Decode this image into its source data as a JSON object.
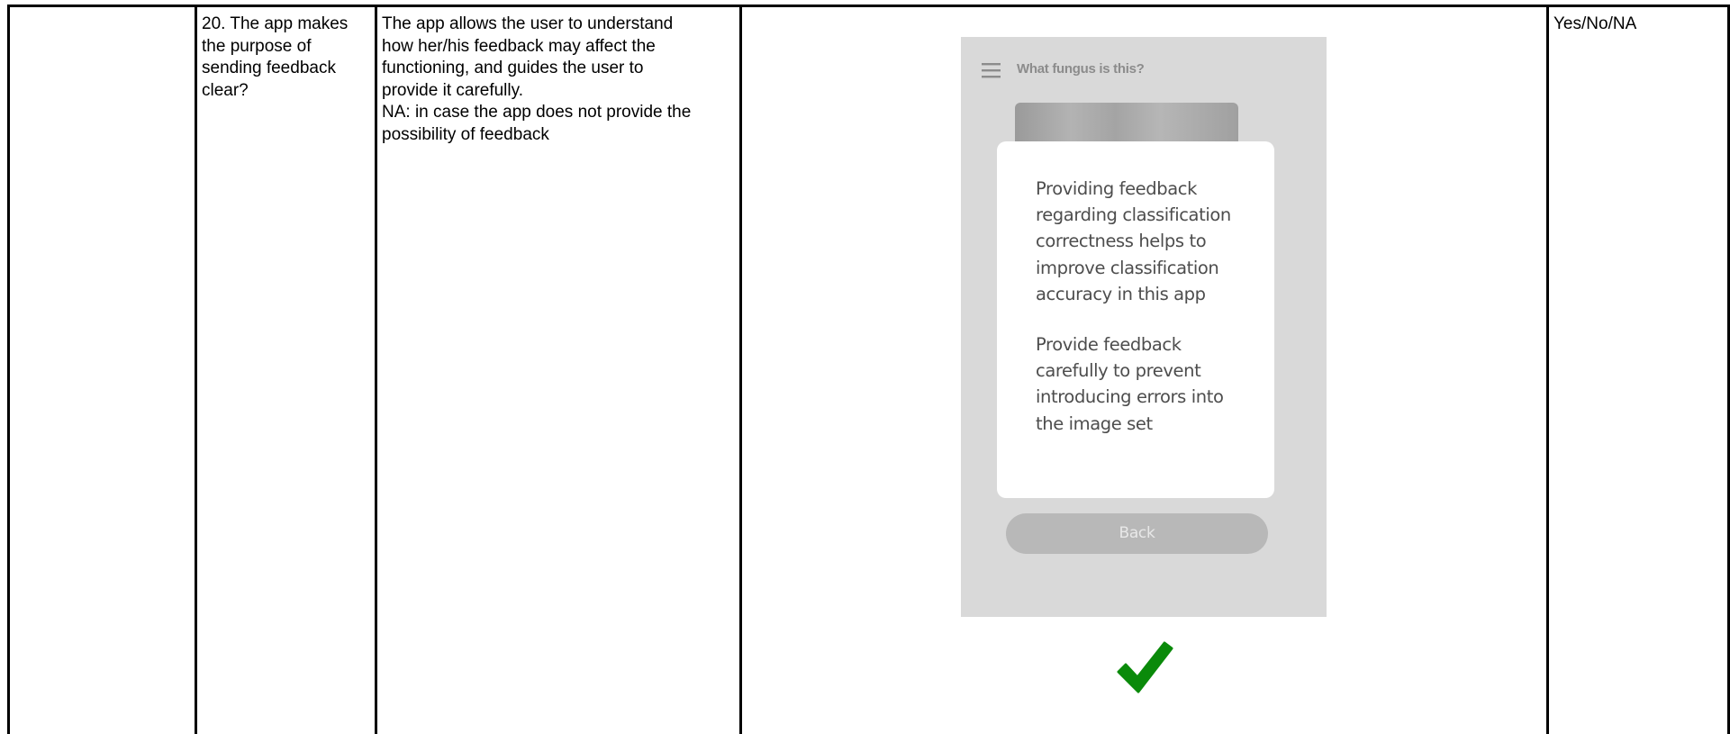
{
  "row": {
    "question": "20. The app makes\nthe purpose of\nsending feedback\nclear?",
    "description": "The app allows the user to understand\nhow her/his feedback may affect the\nfunctioning, and guides the user to\nprovide it carefully.\nNA: in case the app does not provide the\npossibility of feedback",
    "answer_options": "Yes/No/NA"
  },
  "mockup": {
    "app_title": "What fungus is this?",
    "dialog_paragraph_1": "Providing feedback regarding classification correctness helps to improve classification accuracy in this app",
    "dialog_paragraph_2": "Provide feedback carefully to prevent introducing errors into the image set",
    "back_button_label": "Back",
    "icons": [
      "menu-icon",
      "check-icon"
    ]
  },
  "colors": {
    "phone_background": "#d9d9d9",
    "dialog_background": "#ffffff",
    "button_background": "#b8b8b8",
    "check_green": "#0a8a0a"
  }
}
